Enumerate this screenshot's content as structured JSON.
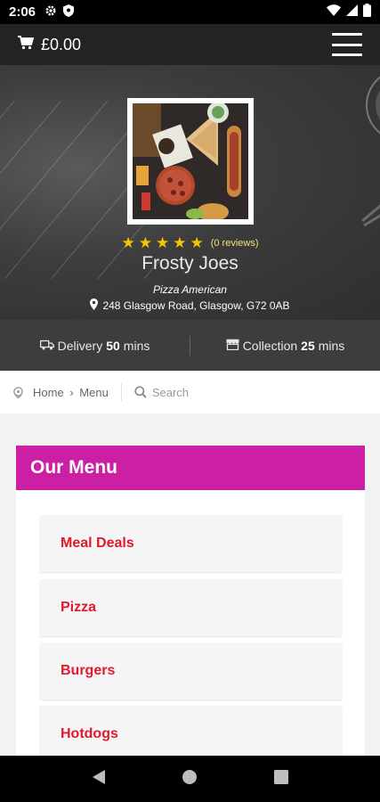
{
  "status": {
    "time": "2:06"
  },
  "topbar": {
    "cart_total": "£0.00"
  },
  "restaurant": {
    "rating_stars": 5,
    "reviews": "(0 reviews)",
    "name": "Frosty Joes",
    "cuisine": "Pizza American",
    "address": "248 Glasgow Road, Glasgow, G72 0AB"
  },
  "times": {
    "delivery_label": "Delivery",
    "delivery_value": "50",
    "collection_label": "Collection",
    "collection_value": "25",
    "unit": "mins"
  },
  "breadcrumb": {
    "home": "Home",
    "separator": "›",
    "current": "Menu"
  },
  "search": {
    "placeholder": "Search"
  },
  "menu": {
    "title": "Our Menu",
    "items": [
      {
        "label": "Meal Deals"
      },
      {
        "label": "Pizza"
      },
      {
        "label": "Burgers"
      },
      {
        "label": "Hotdogs"
      }
    ]
  },
  "colors": {
    "accent": "#cc20a4",
    "item_text": "#e2192c",
    "star": "#f7c600"
  },
  "icons": [
    "settings-icon",
    "shield-icon",
    "wifi-icon",
    "signal-icon",
    "battery-icon",
    "cart-icon",
    "menu-icon",
    "map-pin-icon",
    "delivery-truck-icon",
    "store-icon",
    "location-icon",
    "search-icon",
    "back-icon",
    "home-icon",
    "recents-icon"
  ]
}
